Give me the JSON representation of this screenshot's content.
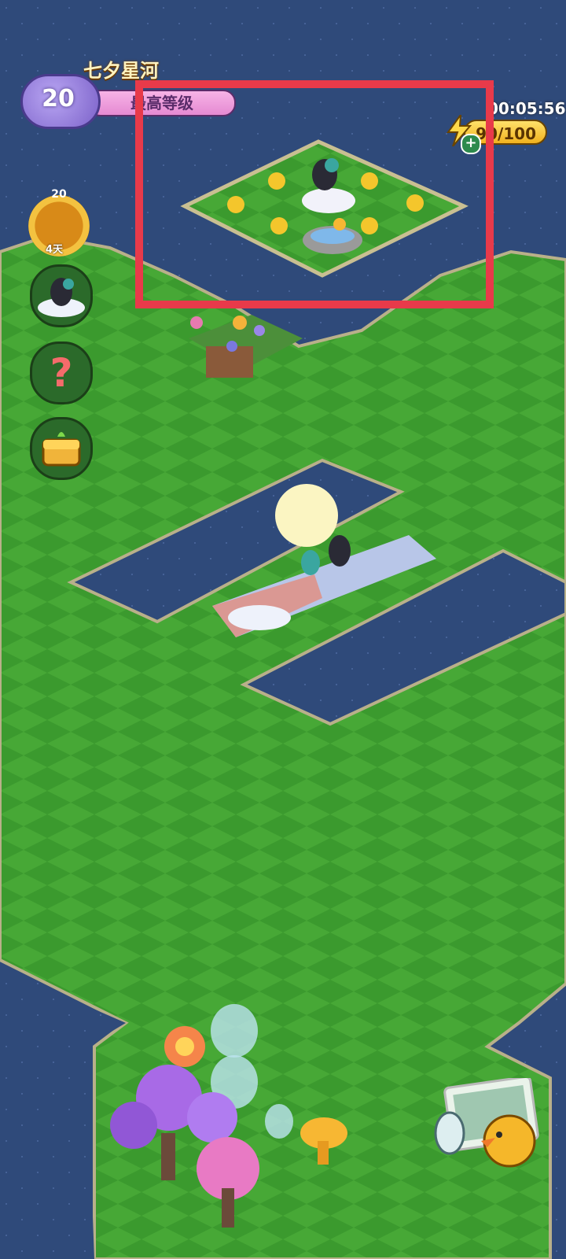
{
  "hud": {
    "event_title": "七夕星河",
    "level_number": "20",
    "level_status": "最高等级",
    "timer": "00:05:56",
    "energy": "90/100",
    "energy_plus": "+"
  },
  "left_buttons": {
    "reward_star_level": "20",
    "reward_days": "4天",
    "help_label": "?"
  },
  "icons": {
    "energy": "lightning-icon",
    "help": "question-icon",
    "shop": "treasure-chest-icon",
    "camera": "camera-icon"
  }
}
